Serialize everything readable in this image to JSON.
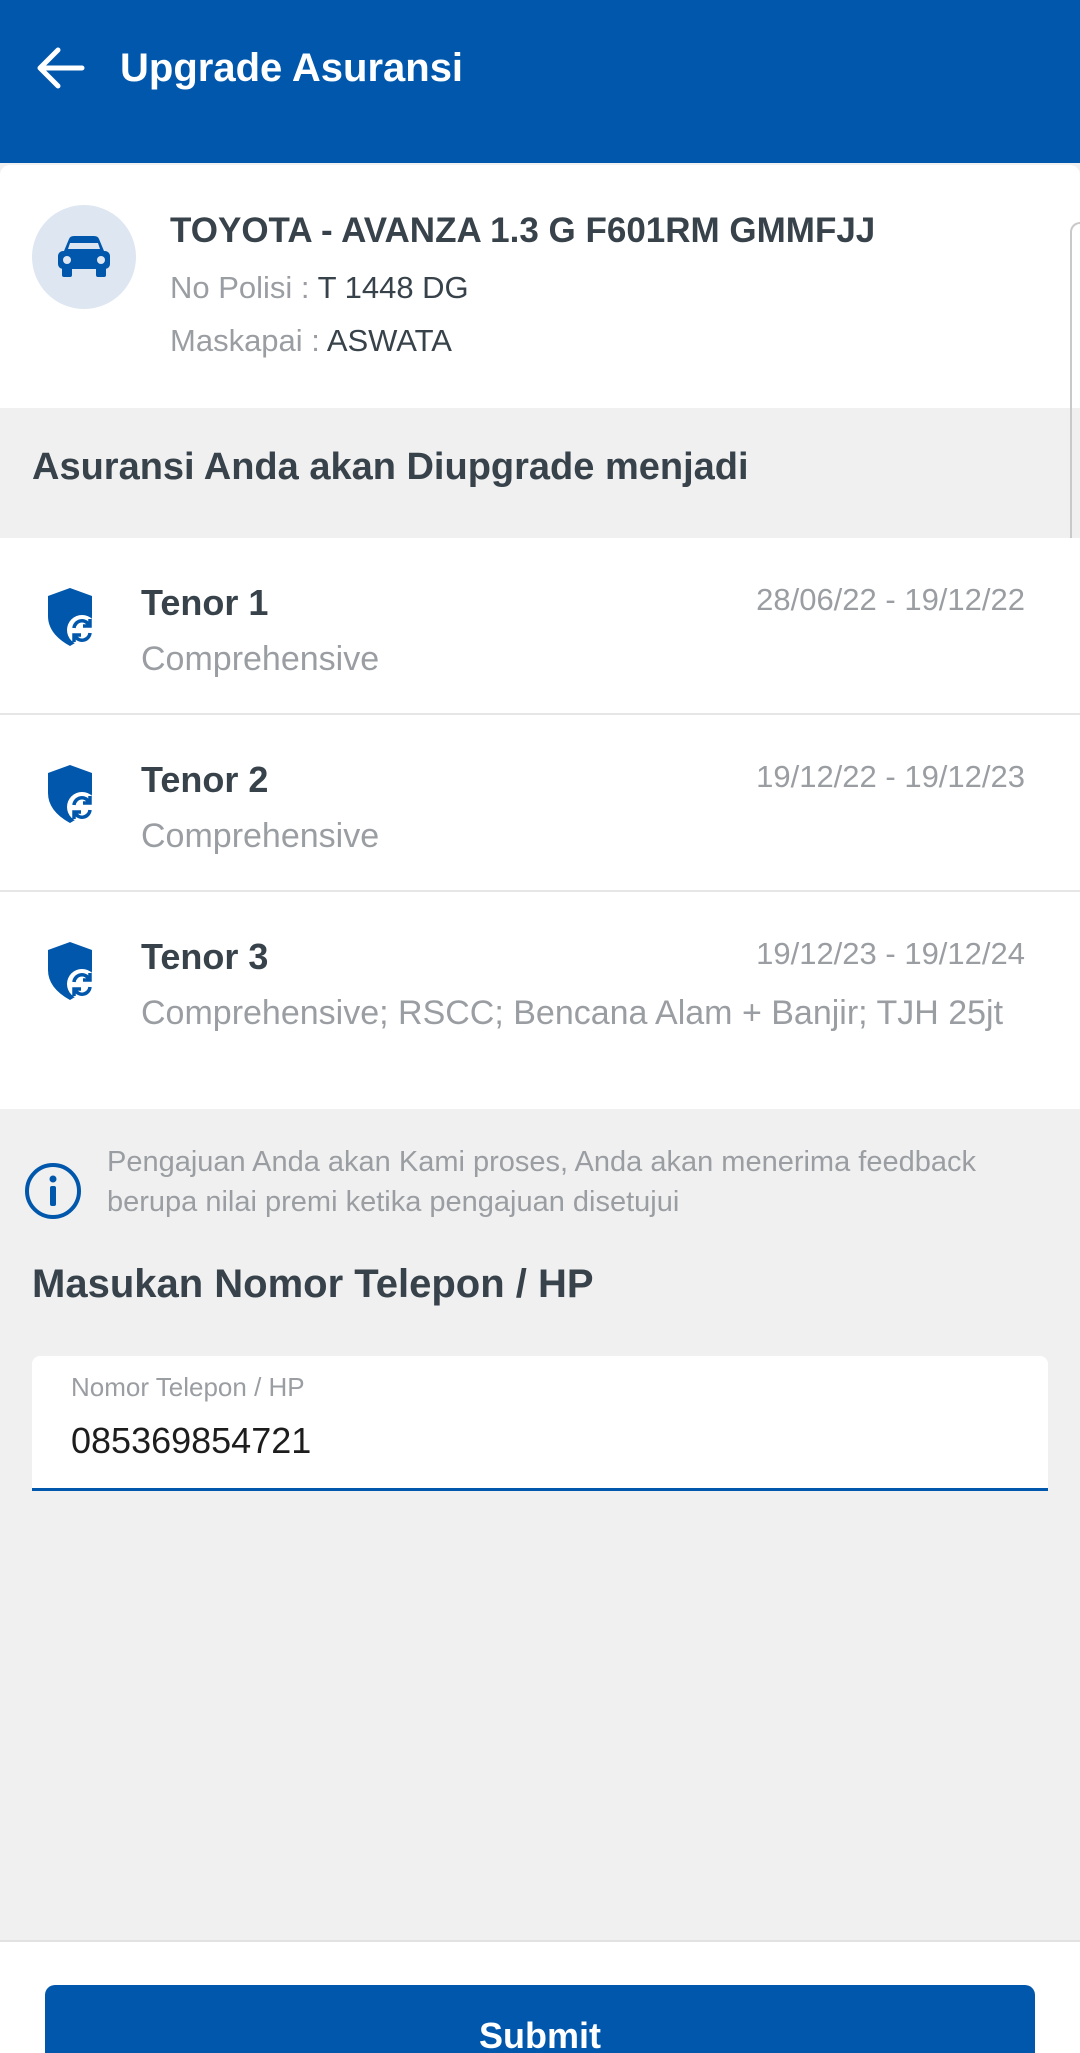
{
  "appbar": {
    "title": "Upgrade Asuransi",
    "back_icon": "arrow-left-icon",
    "color": "#0057ab"
  },
  "vehicle": {
    "icon": "car-icon",
    "name": "TOYOTA - AVANZA 1.3 G F601RM GMMFJJ",
    "polisi_label": "No Polisi : ",
    "polisi_value": "T 1448 DG",
    "maskapai_label": "Maskapai : ",
    "maskapai_value": "ASWATA"
  },
  "upgrade_heading": "Asuransi Anda akan Diupgrade menjadi",
  "tenors": [
    {
      "title": "Tenor 1",
      "dates": "28/06/22 - 19/12/22",
      "coverage": "Comprehensive",
      "icon": "shield-sync-icon"
    },
    {
      "title": "Tenor 2",
      "dates": "19/12/22 - 19/12/23",
      "coverage": "Comprehensive",
      "icon": "shield-sync-icon"
    },
    {
      "title": "Tenor 3",
      "dates": "19/12/23 - 19/12/24",
      "coverage": "Comprehensive; RSCC; Bencana Alam + Banjir; TJH 25jt",
      "icon": "shield-sync-icon"
    }
  ],
  "info": {
    "icon": "info-icon",
    "text": "Pengajuan Anda akan Kami proses, Anda akan menerima feedback berupa nilai premi ketika pengajuan disetujui"
  },
  "phone": {
    "heading": "Masukan Nomor Telepon / HP",
    "label": "Nomor Telepon / HP",
    "value": "085369854721"
  },
  "submit_label": "Submit"
}
